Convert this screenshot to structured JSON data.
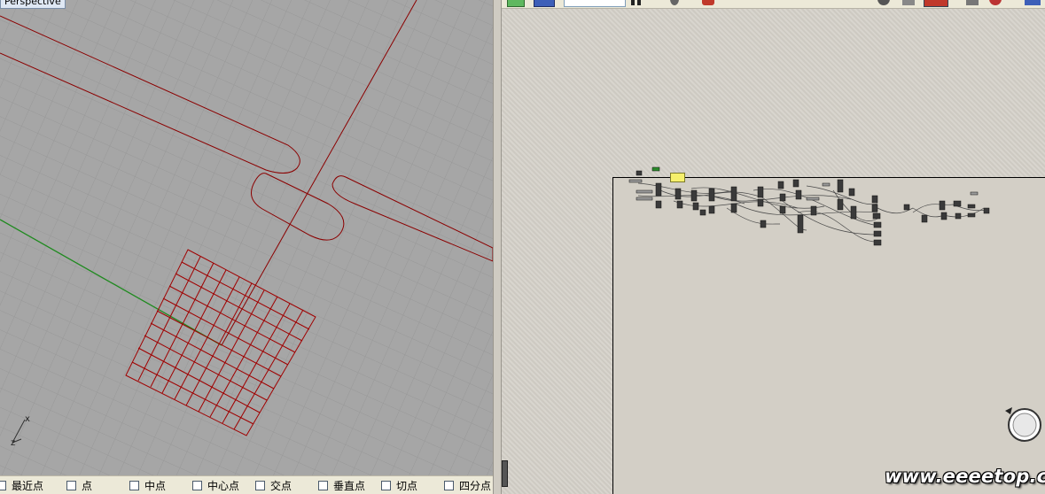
{
  "viewport": {
    "label": "Perspective",
    "axis_labels": {
      "x": "x",
      "z": "z"
    },
    "colors": {
      "background": "#a3a3a3",
      "grid_minor": "#979797",
      "curve": "#8b0000",
      "x_axis": "#228b22"
    }
  },
  "osnap": {
    "items": [
      {
        "label": "最近点"
      },
      {
        "label": "点"
      },
      {
        "label": "中点"
      },
      {
        "label": "中心点"
      },
      {
        "label": "交点"
      },
      {
        "label": "垂直点"
      },
      {
        "label": "切点"
      },
      {
        "label": "四分点"
      }
    ]
  },
  "grasshopper": {
    "toolbar_icons": [
      "green-swatch-icon",
      "folder-icon",
      "zoom-field",
      "pause-icon",
      "eye-icon",
      "color-icon",
      "sphere-icon",
      "cube-icon",
      "red-box-icon",
      "bake-icon",
      "preview-icon"
    ],
    "canvas_color": "#d4d0c8",
    "group_color": "#f6f06c",
    "watermark": "www.eeeetop.com"
  }
}
